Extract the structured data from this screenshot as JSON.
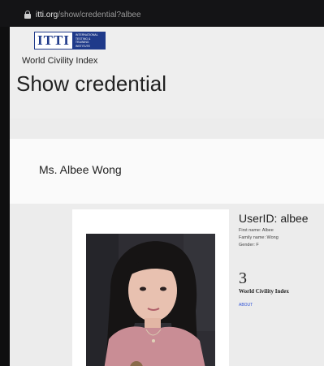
{
  "browser": {
    "url_domain": "itti.org",
    "url_path": "/show/credential?albee"
  },
  "logo": {
    "mark": "ITTI",
    "subtext": "International Testing & Training Institute"
  },
  "brand_name": "World Civility Index",
  "page_title": "Show credential",
  "person_name": "Ms. Albee Wong",
  "credential": {
    "user_id": "UserID: albee",
    "first_name": "First name: Albee",
    "family_name": "Family name: Wong",
    "gender": "Gender: F",
    "score": "3",
    "score_label": "World Civility Index",
    "link_label": "ABOUT"
  },
  "colors": {
    "brand_blue": "#1f3a8a",
    "link_blue": "#2b4fd6",
    "page_bg": "#ececec"
  }
}
